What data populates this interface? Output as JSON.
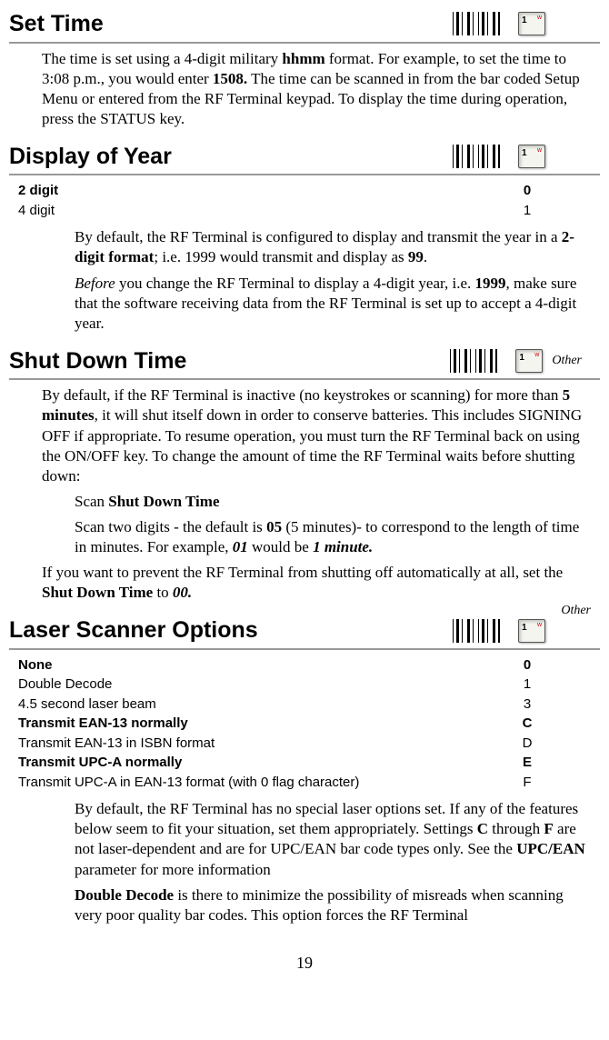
{
  "sections": {
    "setTime": {
      "title": "Set Time",
      "key": "1",
      "para1_a": "The time is set using a 4-digit military ",
      "para1_b": "hhmm",
      "para1_c": " format.  For example, to set the time to 3:08 p.m., you would enter ",
      "para1_d": "1508.",
      "para1_e": " The time can be scanned in from the bar coded Setup Menu or entered from the RF Terminal keypad. To display the time during operation, press the STATUS key."
    },
    "displayOfYear": {
      "title": "Display of Year",
      "key": "1",
      "options": [
        {
          "label": "2 digit",
          "value": "0",
          "bold": true
        },
        {
          "label": "4 digit",
          "value": "1",
          "bold": false
        }
      ],
      "para1_a": "By default, the RF Terminal is configured to display and transmit the year in a ",
      "para1_b": "2-digit format",
      "para1_c": "; i.e. 1999 would transmit and display as ",
      "para1_d": "99",
      "para1_e": ".",
      "para2_a": "Before",
      "para2_b": " you change the RF Terminal to display a 4-digit year, i.e. ",
      "para2_c": "1999",
      "para2_d": ", make sure that the software receiving data from the RF Terminal is set up to accept a 4-digit year."
    },
    "shutDownTime": {
      "title": "Shut Down Time",
      "key": "1",
      "other": "Other",
      "para1_a": "By default, if the RF Terminal is inactive (no keystrokes or scanning) for more than ",
      "para1_b": "5 minutes",
      "para1_c": ", it will shut itself down in order to conserve batteries. This includes SIGNING OFF if appropriate.  To resume operation, you must turn the RF Terminal back on using the ON/OFF key.  To change the amount of time the RF Terminal waits before shutting down:",
      "step1_a": "Scan ",
      "step1_b": "Shut Down Time",
      "step2_a": "Scan two digits - the default is ",
      "step2_b": "05",
      "step2_c": " (5 minutes)- to correspond to the length of time in minutes. For example, ",
      "step2_d": "01",
      "step2_e": " would be ",
      "step2_f": "1 minute.",
      "para3_a": "If you want to prevent the RF Terminal from shutting off automatically at all, set the ",
      "para3_b": "Shut Down Time",
      "para3_c": " to ",
      "para3_d": "00."
    },
    "laserScanner": {
      "title": "Laser Scanner Options",
      "key": "1",
      "other": "Other",
      "options": [
        {
          "label": "None",
          "value": "0",
          "bold": true
        },
        {
          "label": "Double Decode",
          "value": "1",
          "bold": false
        },
        {
          "label": "4.5 second laser beam",
          "value": "3",
          "bold": false
        },
        {
          "label": "Transmit EAN-13 normally",
          "value": "C",
          "bold": true
        },
        {
          "label": "Transmit EAN-13 in ISBN format",
          "value": "D",
          "bold": false
        },
        {
          "label": "Transmit UPC-A normally",
          "value": "E",
          "bold": true
        },
        {
          "label": "Transmit UPC-A in EAN-13 format (with 0 flag character)",
          "value": "F",
          "bold": false
        }
      ],
      "para1_a": "By default, the RF Terminal has no special laser options set.  If any of the features below seem to fit your situation, set them appropriately.  Settings ",
      "para1_b": "C",
      "para1_c": " through ",
      "para1_d": "F",
      "para1_e": " are not laser-dependent and are for UPC/EAN bar code types only.  See the ",
      "para1_f": "UPC/EAN",
      "para1_g": " parameter for more information",
      "para2_a": "Double Decode",
      "para2_b": " is there to minimize the possibility of misreads when scanning very poor quality bar codes.  This option forces the RF Terminal"
    }
  },
  "pageNumber": "19"
}
